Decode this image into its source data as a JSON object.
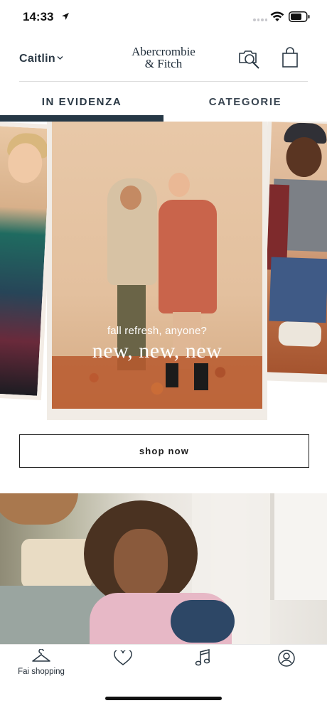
{
  "status_bar": {
    "time": "14:33",
    "icons": [
      "location-arrow-icon",
      "cellular-dots-icon",
      "wifi-icon",
      "battery-icon"
    ]
  },
  "header": {
    "user_name": "Caitlin",
    "logo_line1": "Abercrombie",
    "logo_line2": "& Fitch",
    "icons": [
      "chevron-down-icon",
      "camera-search-icon",
      "shopping-bag-icon"
    ]
  },
  "tabs": [
    {
      "label": "IN EVIDENZA",
      "active": true
    },
    {
      "label": "CATEGORIE",
      "active": false
    }
  ],
  "hero": {
    "subtitle": "fall refresh, anyone?",
    "title": "new, new, new"
  },
  "cta": {
    "shop_now_label": "shop now"
  },
  "bottom_nav": {
    "items": [
      {
        "label": "Fai shopping",
        "icon": "hanger-icon",
        "active": true
      },
      {
        "label": "",
        "icon": "heart-icon"
      },
      {
        "label": "",
        "icon": "music-note-icon"
      },
      {
        "label": "",
        "icon": "account-icon"
      }
    ]
  },
  "colors": {
    "tab_indicator": "#263846",
    "text_primary": "#2b3945",
    "button_border": "#1c1c1c"
  }
}
